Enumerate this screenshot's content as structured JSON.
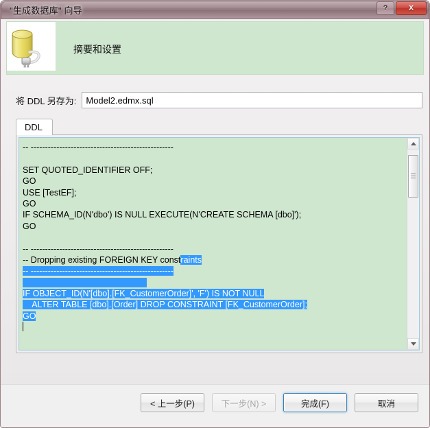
{
  "window": {
    "title": "\"生成数据库\" 向导",
    "help_button": "?",
    "close_button": "X"
  },
  "header": {
    "title": "摘要和设置",
    "icon": "database-plug-icon"
  },
  "ddl_save": {
    "label": "将 DDL 另存为:",
    "value": "Model2.edmx.sql",
    "placeholder": ""
  },
  "tabs": [
    {
      "label": "DDL",
      "selected": true
    }
  ],
  "code": {
    "lines": [
      {
        "text": "-- --------------------------------------------------",
        "selected": false
      },
      {
        "text": "",
        "selected": false
      },
      {
        "text": "SET QUOTED_IDENTIFIER OFF;",
        "selected": false
      },
      {
        "text": "GO",
        "selected": false
      },
      {
        "text": "USE [TestEF];",
        "selected": false
      },
      {
        "text": "GO",
        "selected": false
      },
      {
        "text": "IF SCHEMA_ID(N'dbo') IS NULL EXECUTE(N'CREATE SCHEMA [dbo]');",
        "selected": false
      },
      {
        "text": "GO",
        "selected": false
      },
      {
        "text": "",
        "selected": false
      },
      {
        "text": "-- --------------------------------------------------",
        "selected": false
      },
      {
        "text": "-- Dropping existing FOREIGN KEY const",
        "selected_suffix": "raints",
        "selected": "partial"
      },
      {
        "text": "-- --------------------------------------------------",
        "selected": true
      },
      {
        "text": "",
        "selected": true
      },
      {
        "text": "IF OBJECT_ID(N'[dbo].[FK_CustomerOrder]', 'F') IS NOT NULL",
        "selected": true
      },
      {
        "text": "    ALTER TABLE [dbo].[Order] DROP CONSTRAINT [FK_CustomerOrder];",
        "selected": true
      },
      {
        "text": "GO",
        "selected": true
      },
      {
        "text": "",
        "selected": false,
        "caret": true
      }
    ],
    "selection_color": "#3399ff",
    "background_color": "#cfe6cf",
    "scrollbar": {
      "up_arrow": "▲",
      "down_arrow": "▼"
    }
  },
  "footer": {
    "buttons": [
      {
        "label": "< 上一步(P)",
        "state": "enabled",
        "name": "back-button"
      },
      {
        "label": "下一步(N) >",
        "state": "disabled",
        "name": "next-button"
      },
      {
        "label": "完成(F)",
        "state": "default",
        "name": "finish-button"
      },
      {
        "label": "取消",
        "state": "enabled",
        "name": "cancel-button"
      }
    ]
  },
  "colors": {
    "banner_green": "#cfe6cf",
    "titlebar": "#93797f",
    "close_red": "#bb3529",
    "selection_blue": "#3399ff",
    "default_button_border": "#3c7fb1"
  }
}
